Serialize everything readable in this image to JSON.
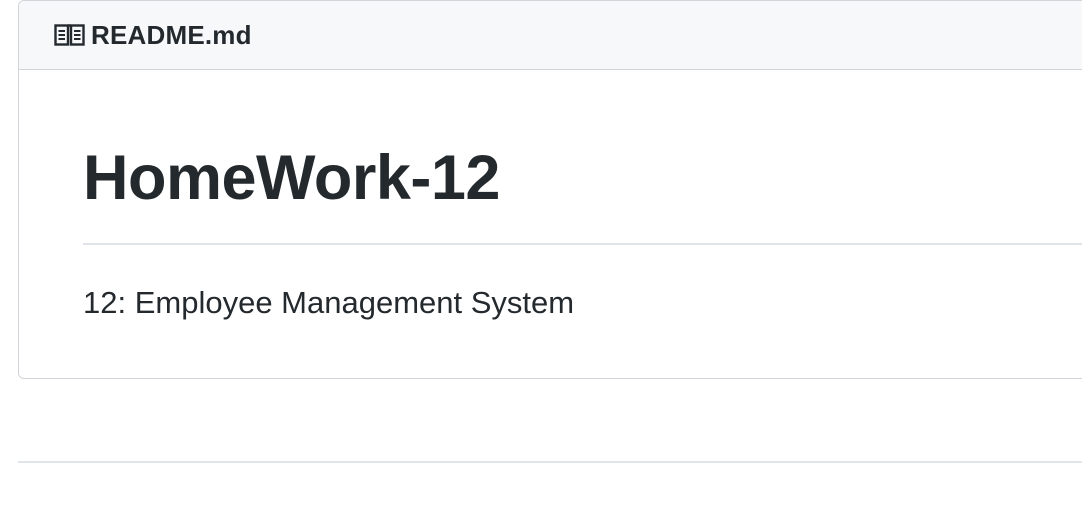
{
  "readme": {
    "filename": "README.md",
    "icon": "book-icon",
    "title": "HomeWork-12",
    "paragraph": "12: Employee Management System"
  },
  "colors": {
    "text": "#24292e",
    "header_bg": "#f6f8fa",
    "border": "#d1d5da",
    "rule": "#e1e4e8"
  }
}
